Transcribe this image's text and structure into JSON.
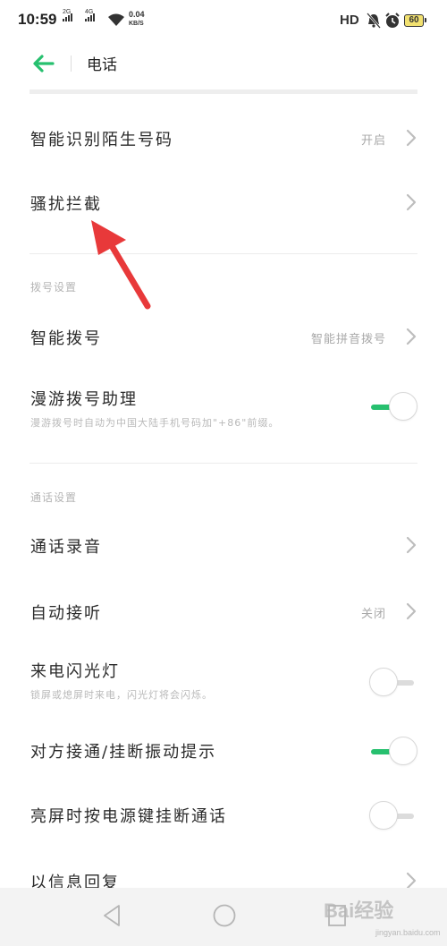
{
  "status_bar": {
    "time": "10:59",
    "network1": "2G",
    "network2": "4G",
    "speed_value": "0.04",
    "speed_unit": "KB/S",
    "hd_label": "HD",
    "battery": "60"
  },
  "header": {
    "title": "电话"
  },
  "rows": {
    "smart_identify": {
      "title": "智能识别陌生号码",
      "value": "开启"
    },
    "harass_block": {
      "title": "骚扰拦截"
    },
    "smart_dial": {
      "title": "智能拨号",
      "value": "智能拼音拨号"
    },
    "roaming": {
      "title": "漫游拨号助理",
      "subtitle": "漫游拨号时自动为中国大陆手机号码加\"+86\"前缀。",
      "enabled": true
    },
    "call_record": {
      "title": "通话录音"
    },
    "auto_answer": {
      "title": "自动接听",
      "value": "关闭"
    },
    "flash": {
      "title": "来电闪光灯",
      "subtitle": "锁屏或熄屏时来电，闪光灯将会闪烁。",
      "enabled": false
    },
    "vibrate": {
      "title": "对方接通/挂断振动提示",
      "enabled": true
    },
    "power_hangup": {
      "title": "亮屏时按电源键挂断通话",
      "enabled": false
    },
    "sms_reply": {
      "title": "以信息回复"
    }
  },
  "sections": {
    "dial_settings": "拨号设置",
    "call_settings": "通话设置"
  },
  "watermark": {
    "text": "Bai经验",
    "url": "jingyan.baidu.com"
  },
  "colors": {
    "accent": "#27c06f",
    "annotation_arrow": "#e8393a"
  }
}
